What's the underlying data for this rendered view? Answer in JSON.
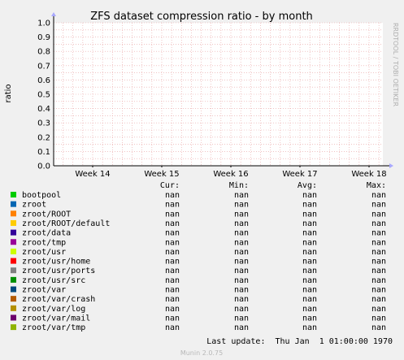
{
  "colors": {
    "background": "#f0f0f0",
    "plot_bg": "#ffffff",
    "grid": "#e8a0a0",
    "axis": "#000000",
    "arrow": "#a8a8ff",
    "watermark": "#b0b0b0",
    "footer": "#b8b8b8"
  },
  "watermark": "RRDTOOL / TOBI OETIKER",
  "legend_headers": [
    "Cur:",
    "Min:",
    "Avg:",
    "Max:"
  ],
  "last_update": "Last update:  Thu Jan  1 01:00:00 1970",
  "footer": "Munin 2.0.75",
  "chart_data": {
    "type": "line",
    "title": "ZFS dataset compression ratio - by month",
    "ylabel": "ratio",
    "xlabel": "",
    "ylim": [
      0,
      1
    ],
    "yticks": [
      "0.0",
      "0.1",
      "0.2",
      "0.3",
      "0.4",
      "0.5",
      "0.6",
      "0.7",
      "0.8",
      "0.9",
      "1.0"
    ],
    "xticks": [
      "Week 14",
      "Week 15",
      "Week 16",
      "Week 17",
      "Week 18"
    ],
    "grid": true,
    "series": [
      {
        "name": "bootpool",
        "color": "#00cc00",
        "cur": "nan",
        "min": "nan",
        "avg": "nan",
        "max": "nan"
      },
      {
        "name": "zroot",
        "color": "#0066b3",
        "cur": "nan",
        "min": "nan",
        "avg": "nan",
        "max": "nan"
      },
      {
        "name": "zroot/ROOT",
        "color": "#ff8000",
        "cur": "nan",
        "min": "nan",
        "avg": "nan",
        "max": "nan"
      },
      {
        "name": "zroot/ROOT/default",
        "color": "#ffcc00",
        "cur": "nan",
        "min": "nan",
        "avg": "nan",
        "max": "nan"
      },
      {
        "name": "zroot/data",
        "color": "#330099",
        "cur": "nan",
        "min": "nan",
        "avg": "nan",
        "max": "nan"
      },
      {
        "name": "zroot/tmp",
        "color": "#990099",
        "cur": "nan",
        "min": "nan",
        "avg": "nan",
        "max": "nan"
      },
      {
        "name": "zroot/usr",
        "color": "#ccff00",
        "cur": "nan",
        "min": "nan",
        "avg": "nan",
        "max": "nan"
      },
      {
        "name": "zroot/usr/home",
        "color": "#ff0000",
        "cur": "nan",
        "min": "nan",
        "avg": "nan",
        "max": "nan"
      },
      {
        "name": "zroot/usr/ports",
        "color": "#808080",
        "cur": "nan",
        "min": "nan",
        "avg": "nan",
        "max": "nan"
      },
      {
        "name": "zroot/usr/src",
        "color": "#008f00",
        "cur": "nan",
        "min": "nan",
        "avg": "nan",
        "max": "nan"
      },
      {
        "name": "zroot/var",
        "color": "#00487d",
        "cur": "nan",
        "min": "nan",
        "avg": "nan",
        "max": "nan"
      },
      {
        "name": "zroot/var/crash",
        "color": "#b35a00",
        "cur": "nan",
        "min": "nan",
        "avg": "nan",
        "max": "nan"
      },
      {
        "name": "zroot/var/log",
        "color": "#b38f00",
        "cur": "nan",
        "min": "nan",
        "avg": "nan",
        "max": "nan"
      },
      {
        "name": "zroot/var/mail",
        "color": "#6b006b",
        "cur": "nan",
        "min": "nan",
        "avg": "nan",
        "max": "nan"
      },
      {
        "name": "zroot/var/tmp",
        "color": "#8fb300",
        "cur": "nan",
        "min": "nan",
        "avg": "nan",
        "max": "nan"
      }
    ]
  }
}
